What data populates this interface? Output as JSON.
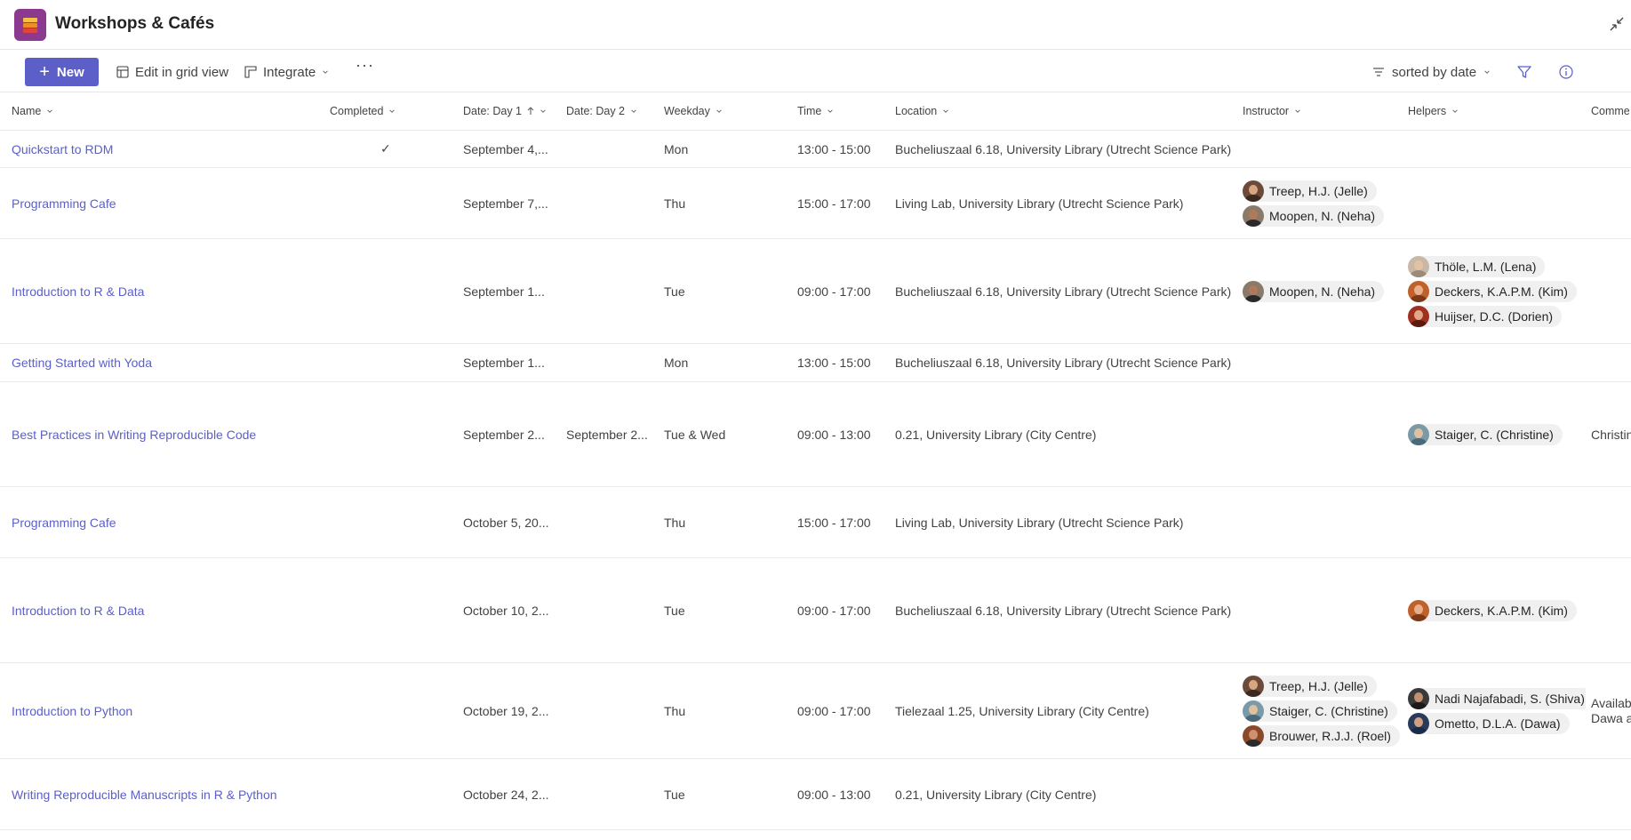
{
  "app": {
    "title": "Workshops & Cafés"
  },
  "toolbar": {
    "new_label": "New",
    "edit_grid_label": "Edit in grid view",
    "integrate_label": "Integrate",
    "more_label": "···",
    "sort_label": "sorted by date"
  },
  "columns": {
    "name": "Name",
    "completed": "Completed",
    "date1": "Date: Day 1",
    "date2": "Date: Day 2",
    "weekday": "Weekday",
    "time": "Time",
    "location": "Location",
    "instructor": "Instructor",
    "helpers": "Helpers",
    "comments": "Comme"
  },
  "rows": [
    {
      "name": "Quickstart to RDM",
      "completed": "✓",
      "date1": "September 4,...",
      "date2": "",
      "weekday": "Mon",
      "time": "13:00 - 15:00",
      "location": "Bucheliuszaal 6.18, University Library (Utrecht Science Park)",
      "instructors": [],
      "helpers": [],
      "comment": ""
    },
    {
      "name": "Programming Cafe",
      "completed": "",
      "date1": "September 7,...",
      "date2": "",
      "weekday": "Thu",
      "time": "15:00 - 17:00",
      "location": "Living Lab, University Library (Utrecht Science Park)",
      "instructors": [
        "Treep, H.J. (Jelle)",
        "Moopen, N. (Neha)"
      ],
      "helpers": [],
      "comment": ""
    },
    {
      "name": "Introduction to R & Data",
      "completed": "",
      "date1": "September 1...",
      "date2": "",
      "weekday": "Tue",
      "time": "09:00 - 17:00",
      "location": "Bucheliuszaal 6.18, University Library (Utrecht Science Park)",
      "instructors": [
        "Moopen, N. (Neha)"
      ],
      "helpers": [
        "Thöle, L.M. (Lena)",
        "Deckers, K.A.P.M. (Kim)",
        "Huijser, D.C. (Dorien)"
      ],
      "comment": ""
    },
    {
      "name": "Getting Started with Yoda",
      "completed": "",
      "date1": "September 1...",
      "date2": "",
      "weekday": "Mon",
      "time": "13:00 - 15:00",
      "location": "Bucheliuszaal 6.18, University Library (Utrecht Science Park)",
      "instructors": [],
      "helpers": [],
      "comment": ""
    },
    {
      "name": "Best Practices in Writing Reproducible Code",
      "completed": "",
      "date1": "September 2...",
      "date2": "September 2...",
      "weekday": "Tue & Wed",
      "time": "09:00 - 13:00",
      "location": "0.21, University Library (City Centre)",
      "instructors": [],
      "helpers": [
        "Staiger, C. (Christine)"
      ],
      "comment": "Christin"
    },
    {
      "name": "Programming Cafe",
      "completed": "",
      "date1": "October 5, 20...",
      "date2": "",
      "weekday": "Thu",
      "time": "15:00 - 17:00",
      "location": "Living Lab, University Library (Utrecht Science Park)",
      "instructors": [],
      "helpers": [],
      "comment": ""
    },
    {
      "name": "Introduction to R & Data",
      "completed": "",
      "date1": "October 10, 2...",
      "date2": "",
      "weekday": "Tue",
      "time": "09:00 - 17:00",
      "location": "Bucheliuszaal 6.18, University Library (Utrecht Science Park)",
      "instructors": [],
      "helpers": [
        "Deckers, K.A.P.M. (Kim)"
      ],
      "comment": ""
    },
    {
      "name": "Introduction to Python",
      "completed": "",
      "date1": "October 19, 2...",
      "date2": "",
      "weekday": "Thu",
      "time": "09:00 - 17:00",
      "location": "Tielezaal 1.25, University Library (City Centre)",
      "instructors": [
        "Treep, H.J. (Jelle)",
        "Staiger, C. (Christine)",
        "Brouwer, R.J.J. (Roel)"
      ],
      "helpers": [
        "Nadi Najafabadi, S. (Shiva)",
        "Ometto, D.L.A. (Dawa)"
      ],
      "comment": "Availab\nDawa a"
    },
    {
      "name": "Writing Reproducible Manuscripts in R & Python",
      "completed": "",
      "date1": "October 24, 2...",
      "date2": "",
      "weekday": "Tue",
      "time": "09:00 - 13:00",
      "location": "0.21, University Library (City Centre)",
      "instructors": [],
      "helpers": [],
      "comment": ""
    }
  ],
  "colors": {
    "accent": "#5b5fc7",
    "app_icon": "#8b3a8f"
  }
}
